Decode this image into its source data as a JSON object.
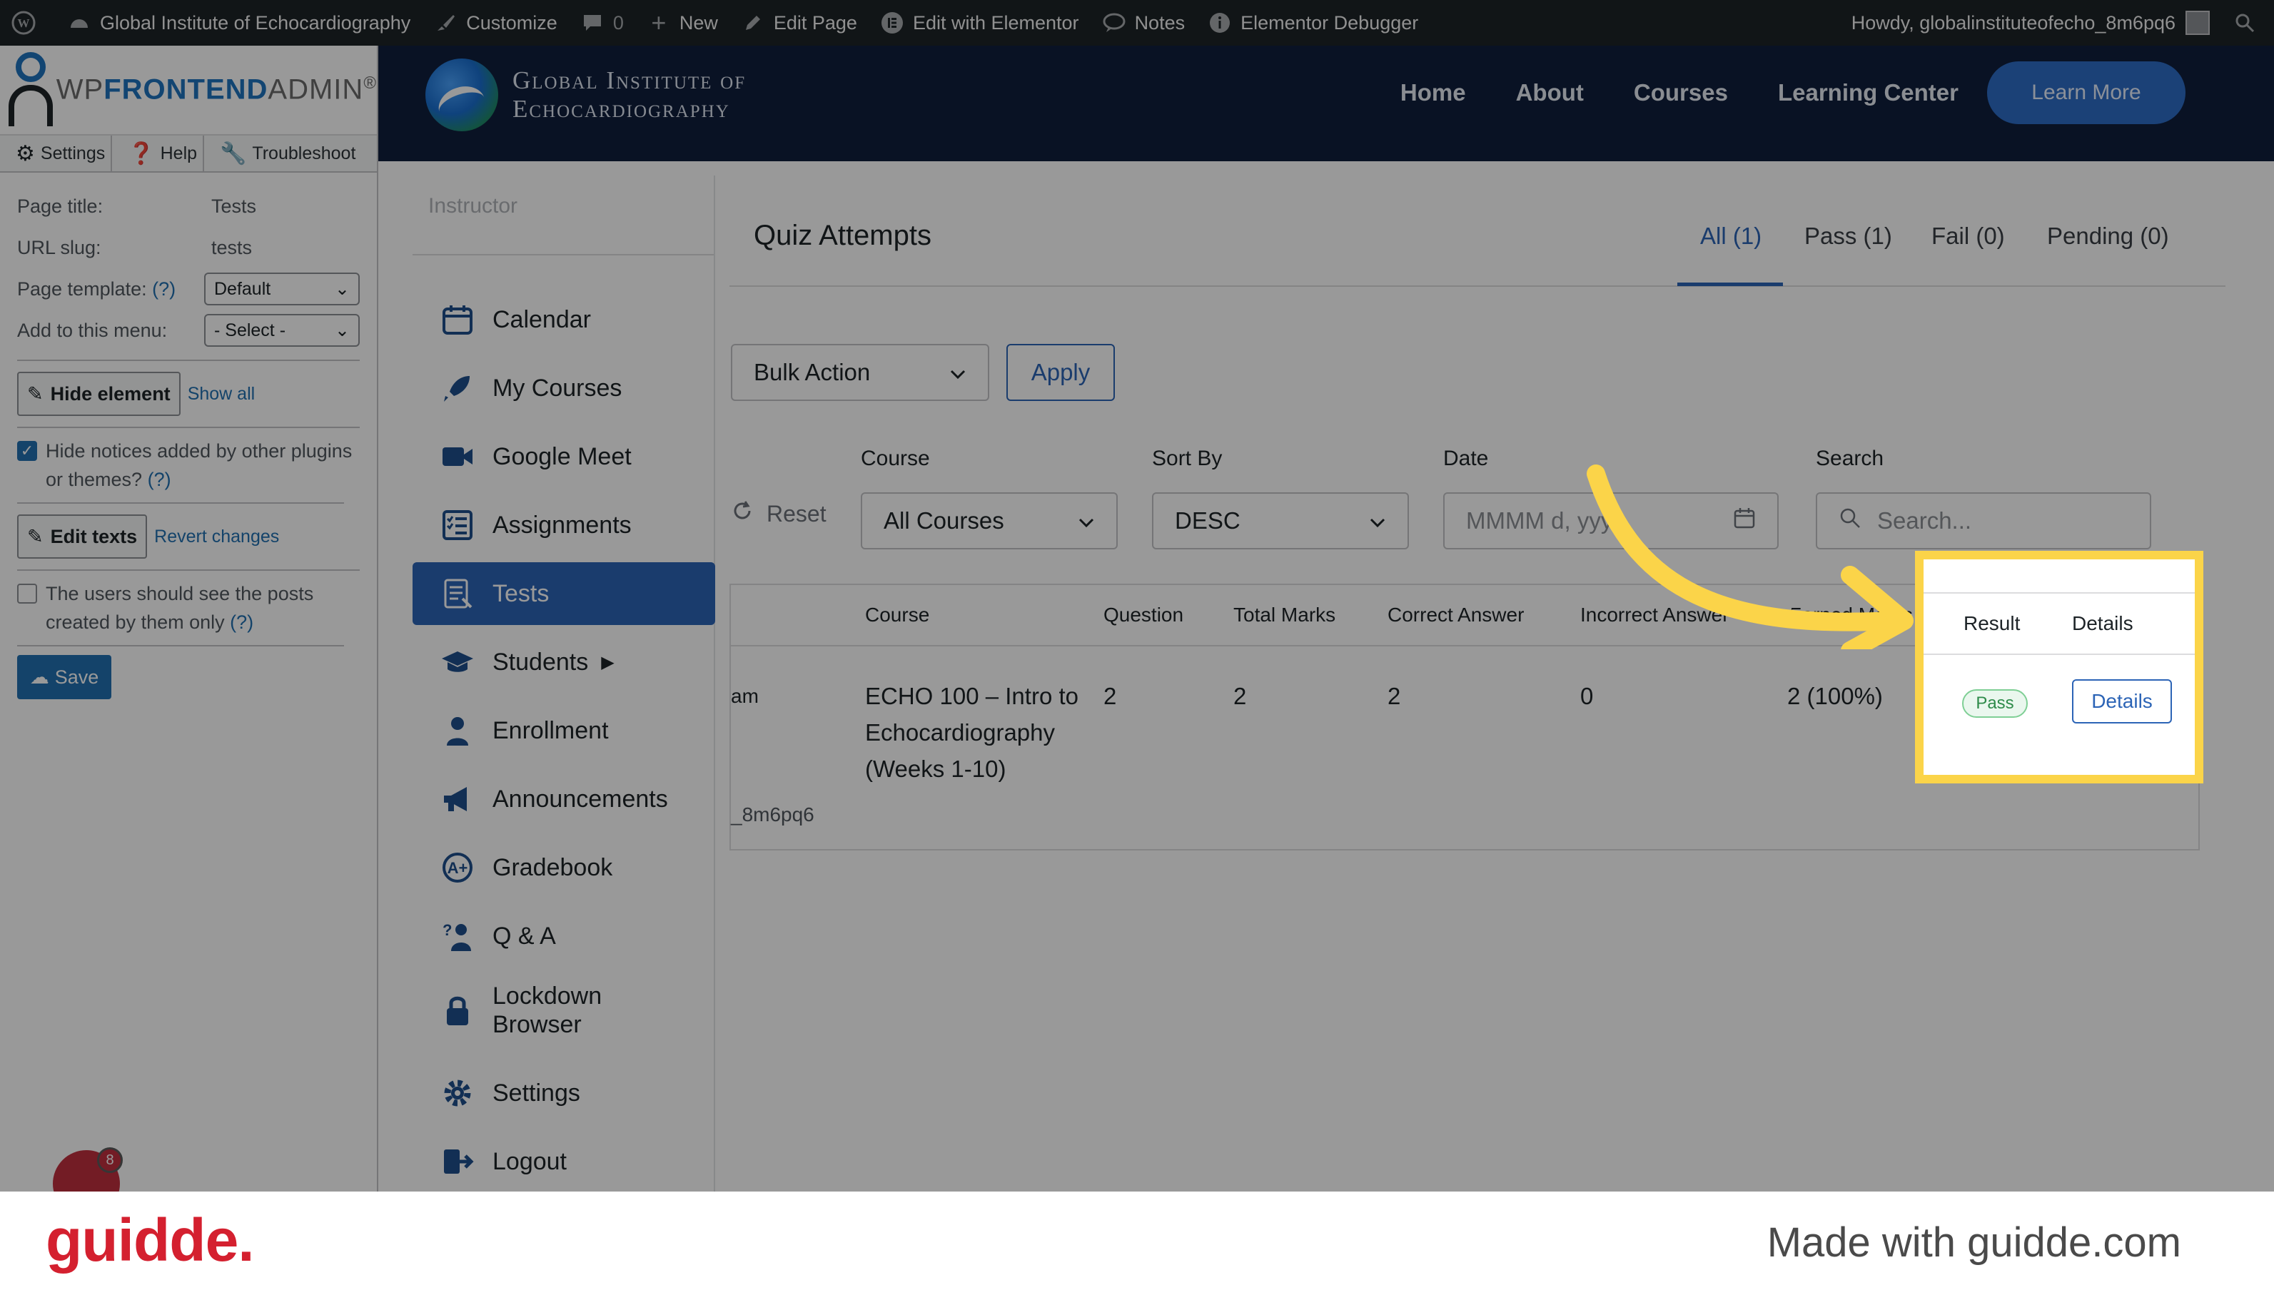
{
  "adminbar": {
    "site_name": "Global Institute of Echocardiography",
    "customize": "Customize",
    "comments_count": "0",
    "new": "New",
    "edit_page": "Edit Page",
    "edit_elementor": "Edit with Elementor",
    "notes": "Notes",
    "debugger": "Elementor Debugger",
    "howdy": "Howdy, globalinstituteofecho_8m6pq6"
  },
  "header": {
    "brand_line1": "Global Institute of",
    "brand_line2": "Echocardiography",
    "nav": [
      "Home",
      "About",
      "Courses",
      "Learning Center"
    ],
    "cta": "Learn More"
  },
  "wpfa": {
    "logo_prefix": "WP",
    "logo_bold": "FRONTEND",
    "logo_suffix": "ADMIN",
    "logo_reg": "®",
    "tabs": [
      "Settings",
      "Help",
      "Troubleshoot"
    ],
    "page_title_label": "Page title:",
    "page_title_value": "Tests",
    "url_slug_label": "URL slug:",
    "url_slug_value": "tests",
    "template_label": "Page template:",
    "help_mark": "(?)",
    "template_value": "Default",
    "menu_label": "Add to this menu:",
    "menu_value": "- Select -",
    "hide_element": "Hide element",
    "show_all": "Show all",
    "hide_notices": "Hide notices added by other plugins or themes?",
    "edit_texts": "Edit texts",
    "revert_changes": "Revert changes",
    "own_posts": "The users should see the posts created by them only",
    "save": "Save"
  },
  "sidebar": {
    "caption": "Instructor",
    "items": [
      {
        "label": "Calendar",
        "icon": "calendar-icon"
      },
      {
        "label": "My Courses",
        "icon": "rocket-icon"
      },
      {
        "label": "Google Meet",
        "icon": "video-camera-icon"
      },
      {
        "label": "Assignments",
        "icon": "checklist-icon"
      },
      {
        "label": "Tests",
        "icon": "document-icon"
      },
      {
        "label": "Students",
        "icon": "graduation-cap-icon"
      },
      {
        "label": "Enrollment",
        "icon": "user-icon"
      },
      {
        "label": "Announcements",
        "icon": "megaphone-icon"
      },
      {
        "label": "Gradebook",
        "icon": "grade-icon"
      },
      {
        "label": "Q & A",
        "icon": "question-person-icon"
      },
      {
        "label": "Lockdown Browser",
        "icon": "lock-icon"
      },
      {
        "label": "Settings",
        "icon": "gear-icon"
      },
      {
        "label": "Logout",
        "icon": "logout-icon"
      }
    ]
  },
  "main": {
    "title": "Quiz Attempts",
    "tabs": [
      "All (1)",
      "Pass (1)",
      "Fail (0)",
      "Pending (0)"
    ],
    "bulk_action": "Bulk Action",
    "apply": "Apply",
    "reset": "Reset",
    "filters": {
      "course_label": "Course",
      "course_value": "All Courses",
      "sort_label": "Sort By",
      "sort_value": "DESC",
      "date_label": "Date",
      "date_placeholder": "MMMM d, yyyy",
      "search_label": "Search",
      "search_placeholder": "Search..."
    },
    "table": {
      "headers": [
        "Course",
        "Question",
        "Total Marks",
        "Correct Answer",
        "Incorrect Answer",
        "Earned Marks",
        "Result",
        "Details"
      ],
      "row": {
        "quiz_fragment": "am",
        "user_fragment": "_8m6pq6",
        "course": "ECHO 100 – Intro to Echocardiography (Weeks 1-10)",
        "question": "2",
        "total_marks": "2",
        "correct": "2",
        "incorrect": "0",
        "earned": "2 (100%)",
        "result": "Pass",
        "details": "Details"
      }
    }
  },
  "bubble_count": "8",
  "footer": {
    "brand": "guidde.",
    "made_with": "Made with guidde.com"
  },
  "colors": {
    "highlight": "#fbd449",
    "accent": "#2c64b6",
    "header_bg": "#0f1f3d",
    "pass_green": "#2e8b4a"
  }
}
